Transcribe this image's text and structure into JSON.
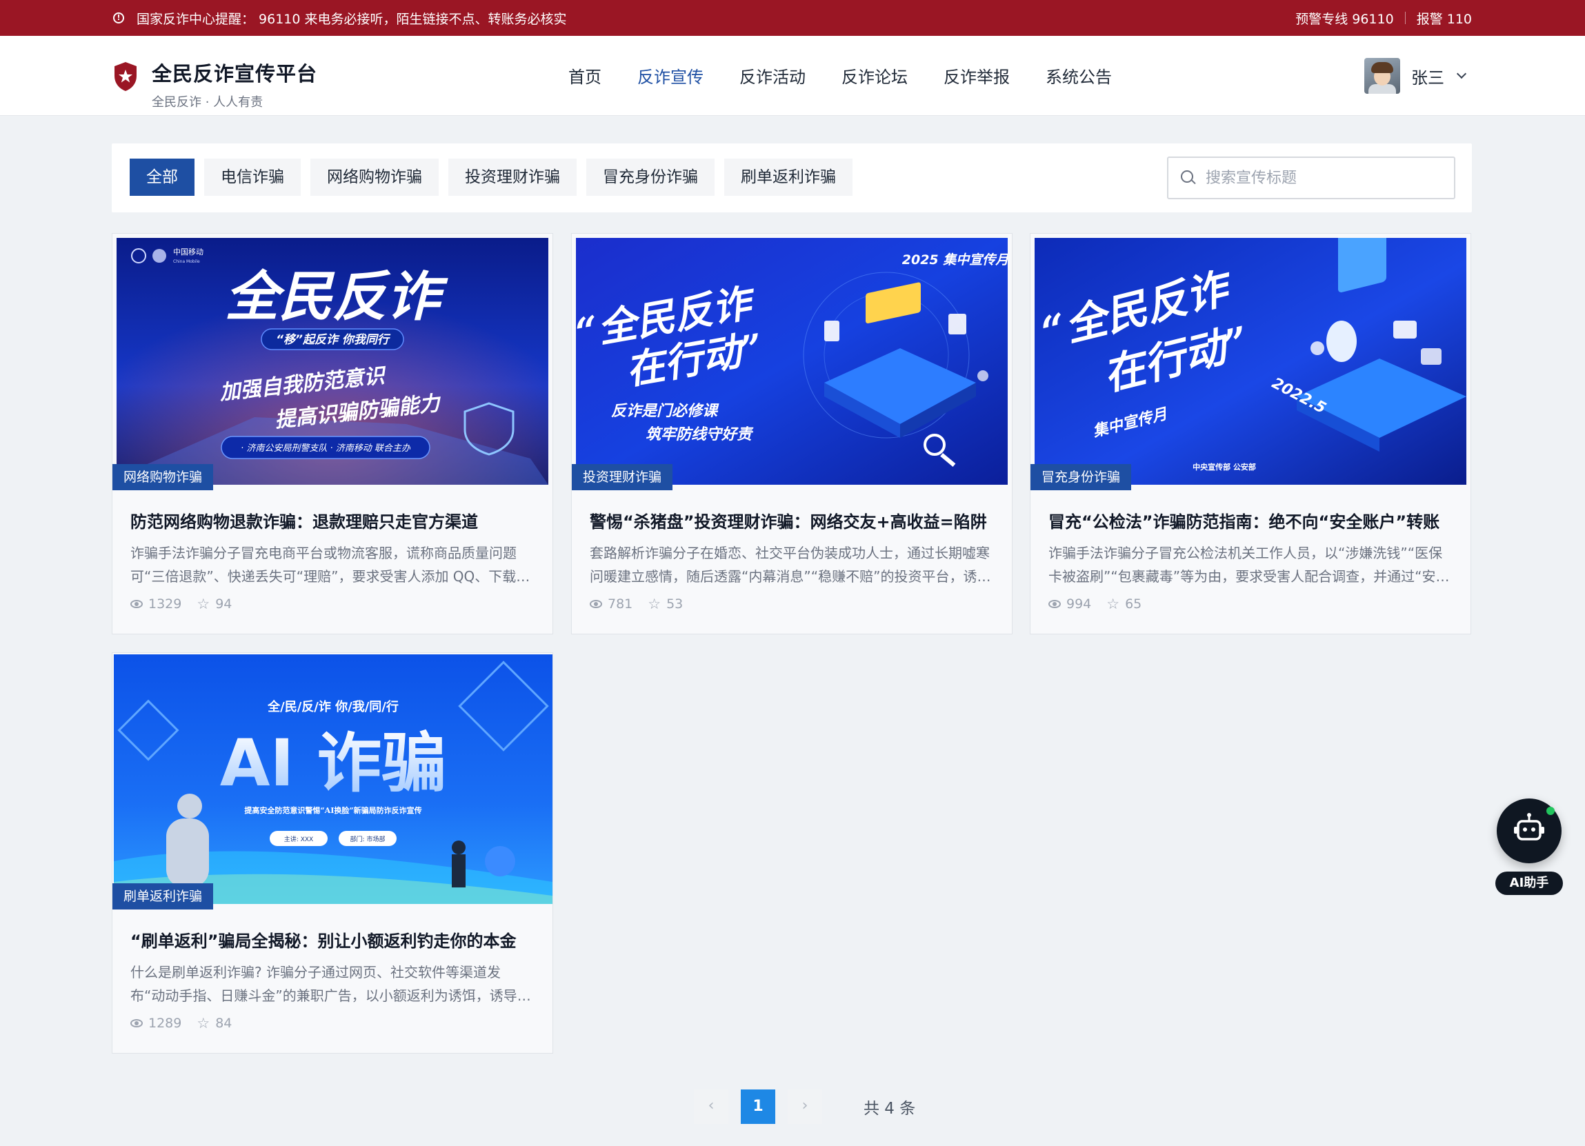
{
  "alert": {
    "icon": "info-icon",
    "notice": "国家反诈中心提醒：  96110  来电务必接听，陌生链接不点、转账务必核实",
    "hotline": "预警专线 96110",
    "police": "报警 110"
  },
  "brand": {
    "title": "全民反诈宣传平台",
    "slogan": "全民反诈 · 人人有责",
    "color": "#9a1624"
  },
  "nav": [
    "首页",
    "反诈宣传",
    "反诈活动",
    "反诈论坛",
    "反诈举报",
    "系统公告"
  ],
  "nav_active": "反诈宣传",
  "user": {
    "name": "张三"
  },
  "filter": {
    "tabs": [
      "全部",
      "电信诈骗",
      "网络购物诈骗",
      "投资理财诈骗",
      "冒充身份诈骗",
      "刷单返利诈骗"
    ],
    "active": "全部",
    "search_placeholder": "搜索宣传标题"
  },
  "cards": [
    {
      "tag": "网络购物诈骗",
      "title": "防范网络购物退款诈骗：退款理赔只走官方渠道",
      "desc": "诈骗手法诈骗分子冒充电商平台或物流客服，谎称商品质量问题可“三倍退款”、快递丢失可“理赔”，要求受害人添加 QQ、下载会议软件，诱导提供银行卡号、验证码等信息。",
      "views": "1329",
      "stars": "94",
      "banner": {
        "org": "中国移动",
        "org_en": "China Mobile",
        "headline": "全民反诈",
        "ribbon": "“移”起反诈  你我同行",
        "line1": "加强自我防范意识",
        "line2": "提高识骗防骗能力",
        "foot": "· 济南公安局刑警支队  · 济南移动  联合主办"
      }
    },
    {
      "tag": "投资理财诈骗",
      "title": "警惕“杀猪盘”投资理财诈骗：网络交友+高收益=陷阱",
      "desc": "套路解析诈骗分子在婚恋、社交平台伪装成功人士，通过长期嘘寒问暖建立感情，随后透露“内幕消息”“稳赚不赔”的投资平台，诱导受害人不断加大投入。",
      "views": "781",
      "stars": "53",
      "banner": {
        "year": "2025  集中宣传月",
        "headline1": "“全民反诈",
        "headline2": "在行动”",
        "sub1": "反诈是门必修课",
        "sub2": "筑牢防线守好责"
      }
    },
    {
      "tag": "冒充身份诈骗",
      "title": "冒充“公检法”诈骗防范指南：绝不向“安全账户”转账",
      "desc": "诈骗手法诈骗分子冒充公检法机关工作人员，以“涉嫌洗钱”“医保卡被盗刷”“包裹藏毒”等为由，要求受害人配合调查，并通过“安全账户”转走资金。",
      "views": "994",
      "stars": "65",
      "banner": {
        "headline1": "“全民反诈",
        "headline2": "在行动”",
        "sub": "集中宣传月",
        "date": "2022.5",
        "org": "中央宣传部  公安部"
      }
    },
    {
      "tag": "刷单返利诈骗",
      "title": "“刷单返利”骗局全揭秘：别让小额返利钓走你的本金",
      "desc": "什么是刷单返利诈骗? 诈骗分子通过网页、社交软件等渠道发布“动动手指、日赚斗金”的兼职广告，以小额返利为诱饵，诱导受害人不断垫付资金。",
      "views": "1289",
      "stars": "84",
      "banner": {
        "top": "全/民/反/诈  你/我/同/行",
        "headline": "AI 诈骗",
        "sub": "提高安全防范意识警惕“AI换脸”新骗局防诈反诈宣传",
        "pill1": "主讲: XXX",
        "pill2": "部门: 市场部"
      }
    }
  ],
  "pagination": {
    "prev": "‹",
    "current": "1",
    "next": "›",
    "total": "共 4 条"
  },
  "ai": {
    "label": "AI助手",
    "icon": "robot-icon"
  }
}
